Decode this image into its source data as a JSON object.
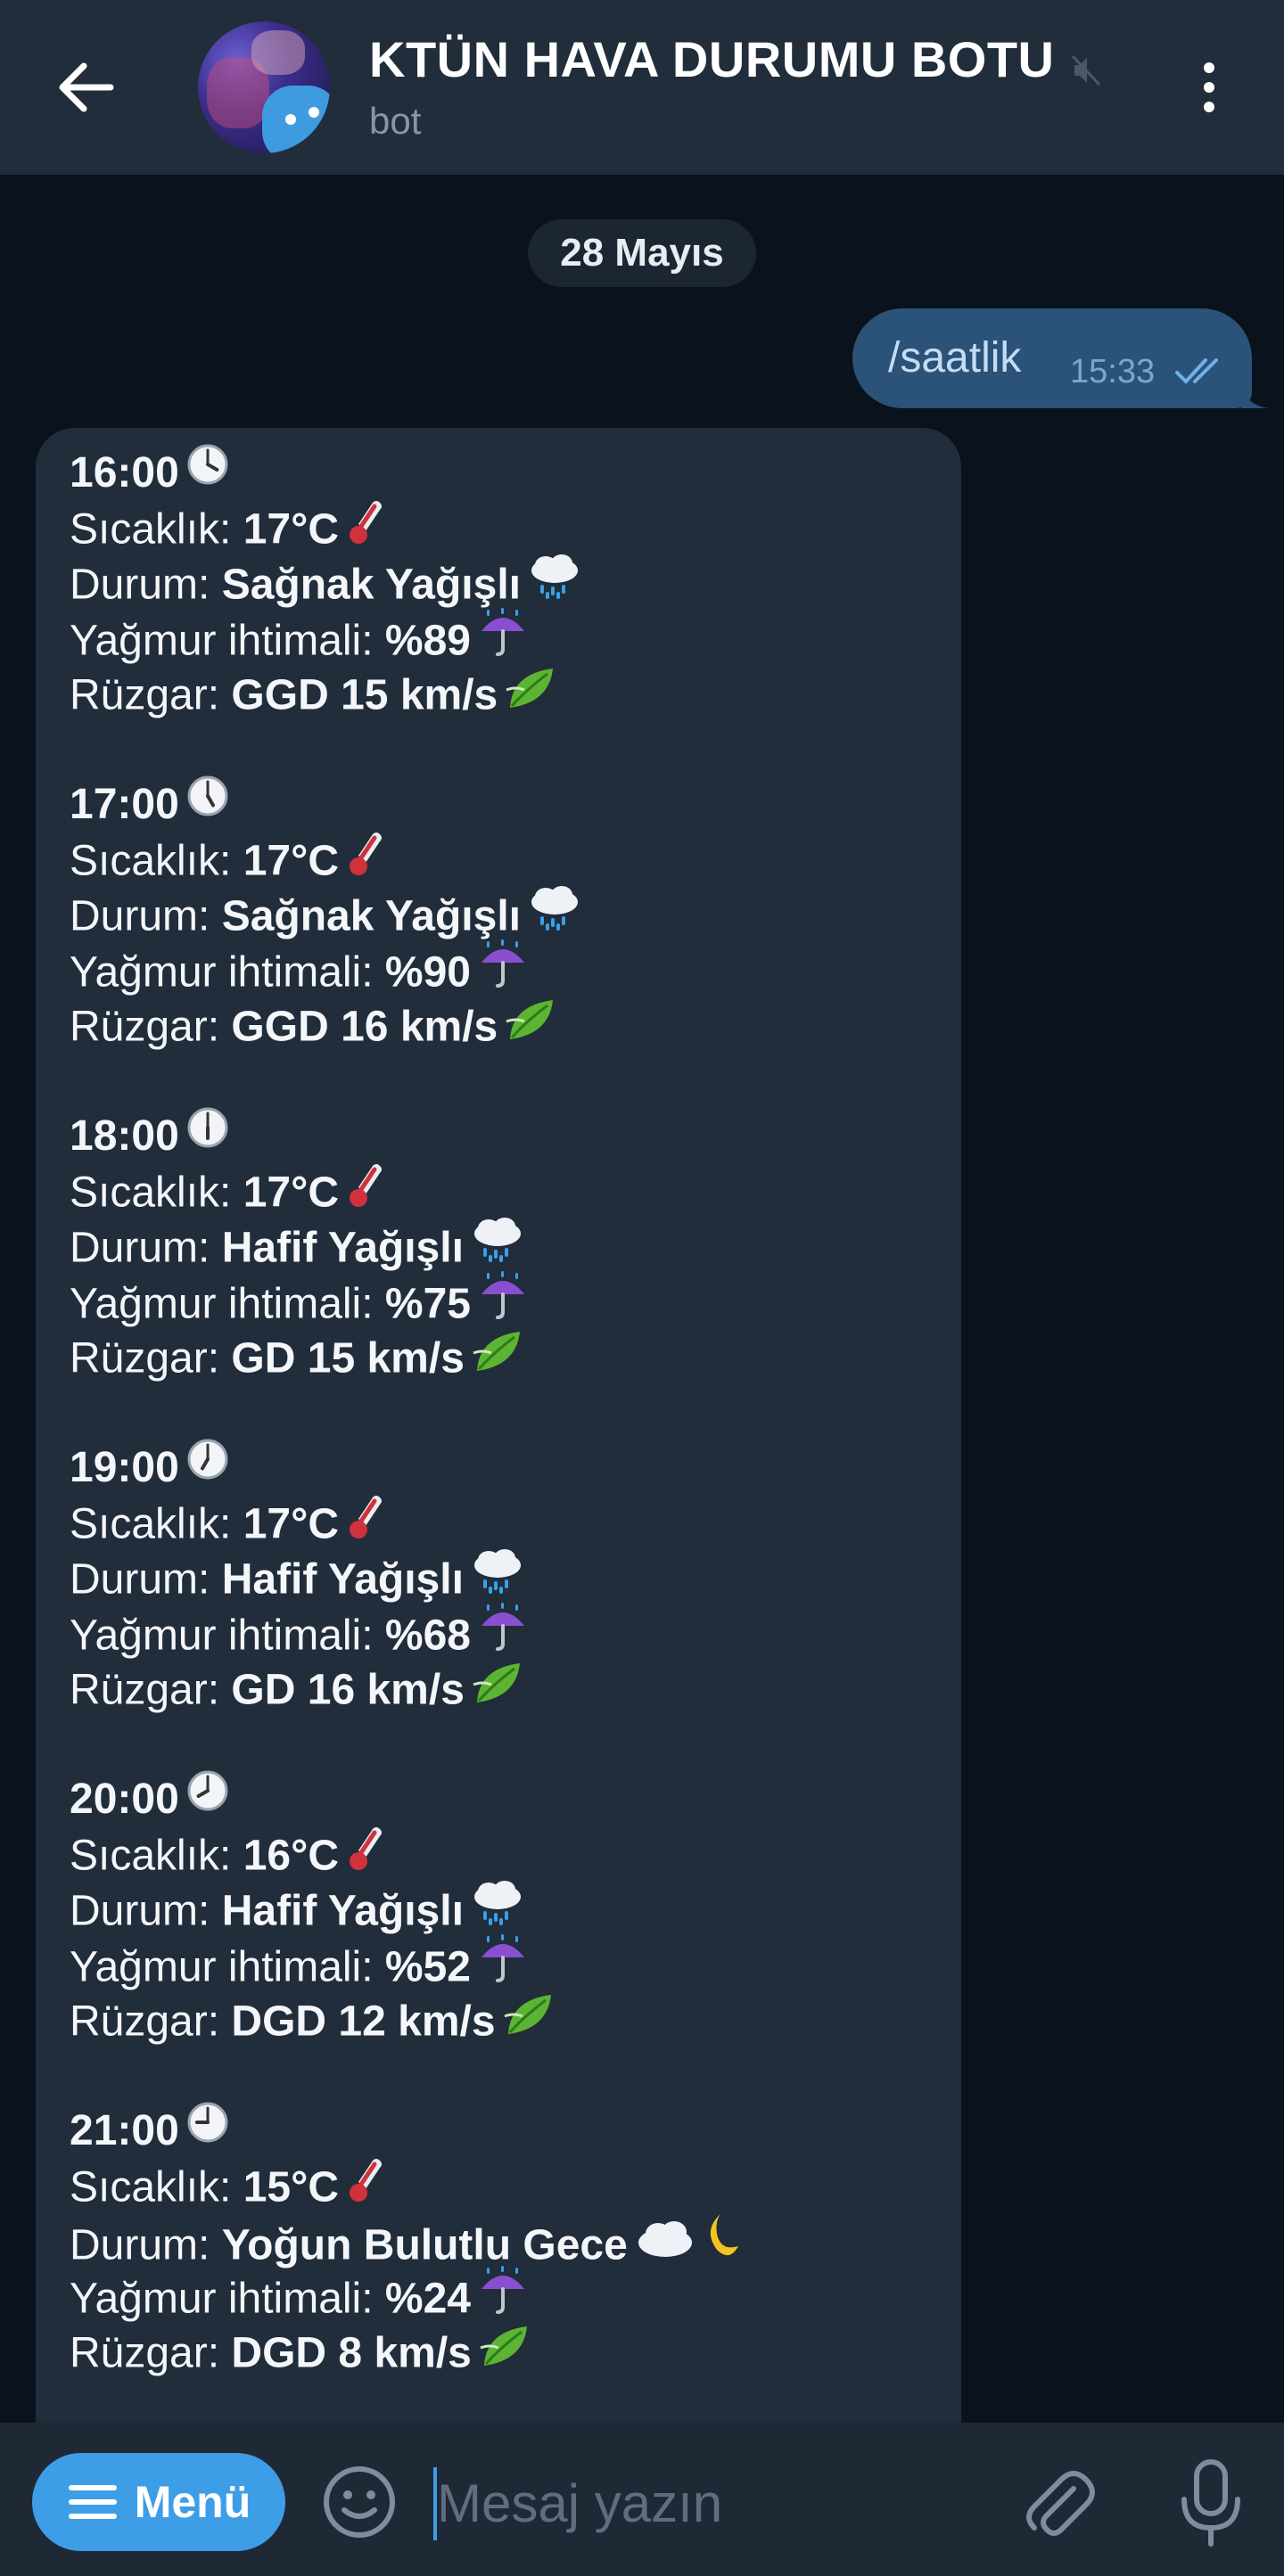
{
  "header": {
    "title": "KTÜN HAVA DURUMU BOTU",
    "subtitle": "bot",
    "icons": [
      "back-arrow-icon",
      "avatar",
      "mute-icon",
      "more-vert-icon"
    ]
  },
  "date_separator": "28 Mayıs",
  "outgoing_message": {
    "text": "/saatlik",
    "time": "15:33",
    "status": "read"
  },
  "labels": {
    "temperature": "Sıcaklık:",
    "condition": "Durum:",
    "rain_chance": "Yağmur ihtimali:",
    "wind": "Rüzgar:"
  },
  "forecast": [
    {
      "time": "16:00",
      "temperature": "17°C",
      "condition": "Sağnak Yağışlı",
      "rain": "%89",
      "wind": "GGD 15 km/s"
    },
    {
      "time": "17:00",
      "temperature": "17°C",
      "condition": "Sağnak Yağışlı",
      "rain": "%90",
      "wind": "GGD 16 km/s"
    },
    {
      "time": "18:00",
      "temperature": "17°C",
      "condition": "Hafif Yağışlı",
      "rain": "%75",
      "wind": "GD 15 km/s"
    },
    {
      "time": "19:00",
      "temperature": "17°C",
      "condition": "Hafif Yağışlı",
      "rain": "%68",
      "wind": "GD 16 km/s"
    },
    {
      "time": "20:00",
      "temperature": "16°C",
      "condition": "Hafif Yağışlı",
      "rain": "%52",
      "wind": "DGD 12 km/s"
    },
    {
      "time": "21:00",
      "temperature": "15°C",
      "condition": "Yoğun Bulutlu Gece",
      "rain": "%24",
      "wind": "DGD 8 km/s"
    }
  ],
  "composer": {
    "menu_label": "Menü",
    "placeholder": "Mesaj yazın"
  },
  "colors": {
    "header_bg": "#212d3b",
    "chat_bg": "#0a121b",
    "outgoing_bubble": "#2b5278",
    "incoming_bubble": "#212d3b",
    "accent": "#3d9ee7"
  }
}
